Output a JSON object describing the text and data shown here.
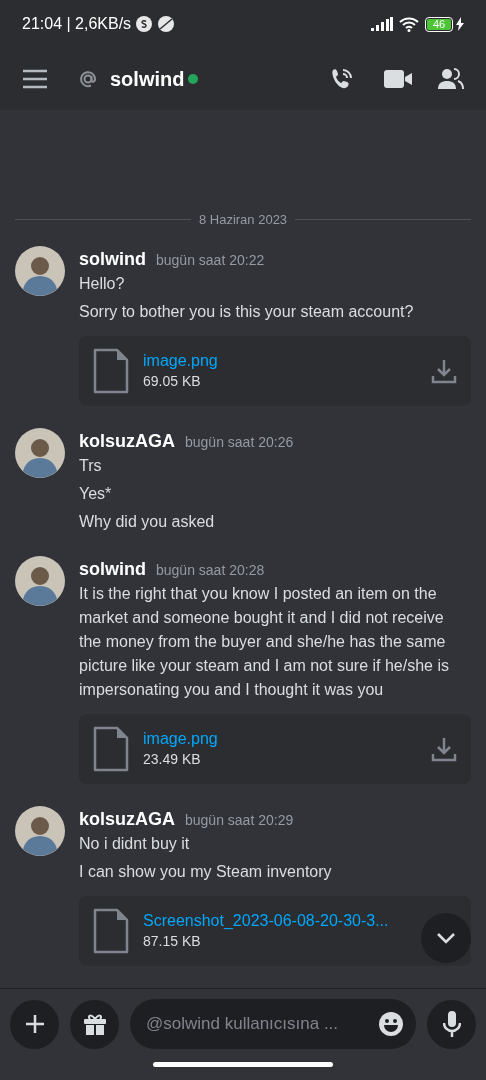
{
  "status_bar": {
    "time_speed": "21:04 | 2,6KB/s",
    "battery": "46",
    "charging": true
  },
  "header": {
    "channel": "solwind",
    "online": true
  },
  "date_divider": "8 Haziran 2023",
  "messages": [
    {
      "author": "solwind",
      "time": "bugün saat 20:22",
      "lines": [
        "Hello?",
        "Sorry to bother you is this your steam account?"
      ],
      "attachments": [
        {
          "name": "image.png",
          "size": "69.05 KB",
          "download_button": true
        }
      ]
    },
    {
      "author": "kolsuzAGA",
      "time": "bugün saat 20:26",
      "lines": [
        "Trs",
        "Yes*",
        "Why did you asked"
      ]
    },
    {
      "author": "solwind",
      "time": "bugün saat 20:28",
      "lines": [
        "It is the right that you know I posted an item on the market and someone bought it and I did not receive the money  from the buyer and she/he has the same picture like your steam and I am  not sure if he/she is impersonating you and I thought it was you"
      ],
      "attachments": [
        {
          "name": "image.png",
          "size": "23.49 KB",
          "download_button": true
        }
      ]
    },
    {
      "author": "kolsuzAGA",
      "time": "bugün saat 20:29",
      "lines": [
        "No i didnt buy it",
        "I can show you my Steam inventory"
      ],
      "attachments": [
        {
          "name": "Screenshot_2023-06-08-20-30-3...",
          "size": "87.15 KB"
        }
      ]
    }
  ],
  "composer": {
    "placeholder": "@solwind kullanıcısına ..."
  }
}
